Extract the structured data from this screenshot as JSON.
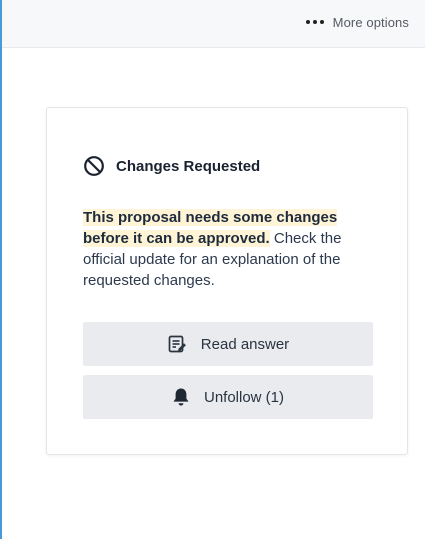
{
  "header": {
    "more_options_label": "More options",
    "more_icon": "ellipsis-icon"
  },
  "status": {
    "icon": "prohibited-icon",
    "title": "Changes Requested"
  },
  "message": {
    "highlight": "This proposal needs some changes before it can be approved.",
    "rest": " Check the official update for an explanation of the requested changes."
  },
  "actions": {
    "read_answer": {
      "label": "Read answer",
      "icon": "document-edit-icon"
    },
    "unfollow": {
      "label": "Unfollow (1)",
      "icon": "bell-icon"
    }
  },
  "colors": {
    "highlight_background": "#fff5d6",
    "button_background": "#e9ebee",
    "frame_accent": "#4a9ad8"
  }
}
